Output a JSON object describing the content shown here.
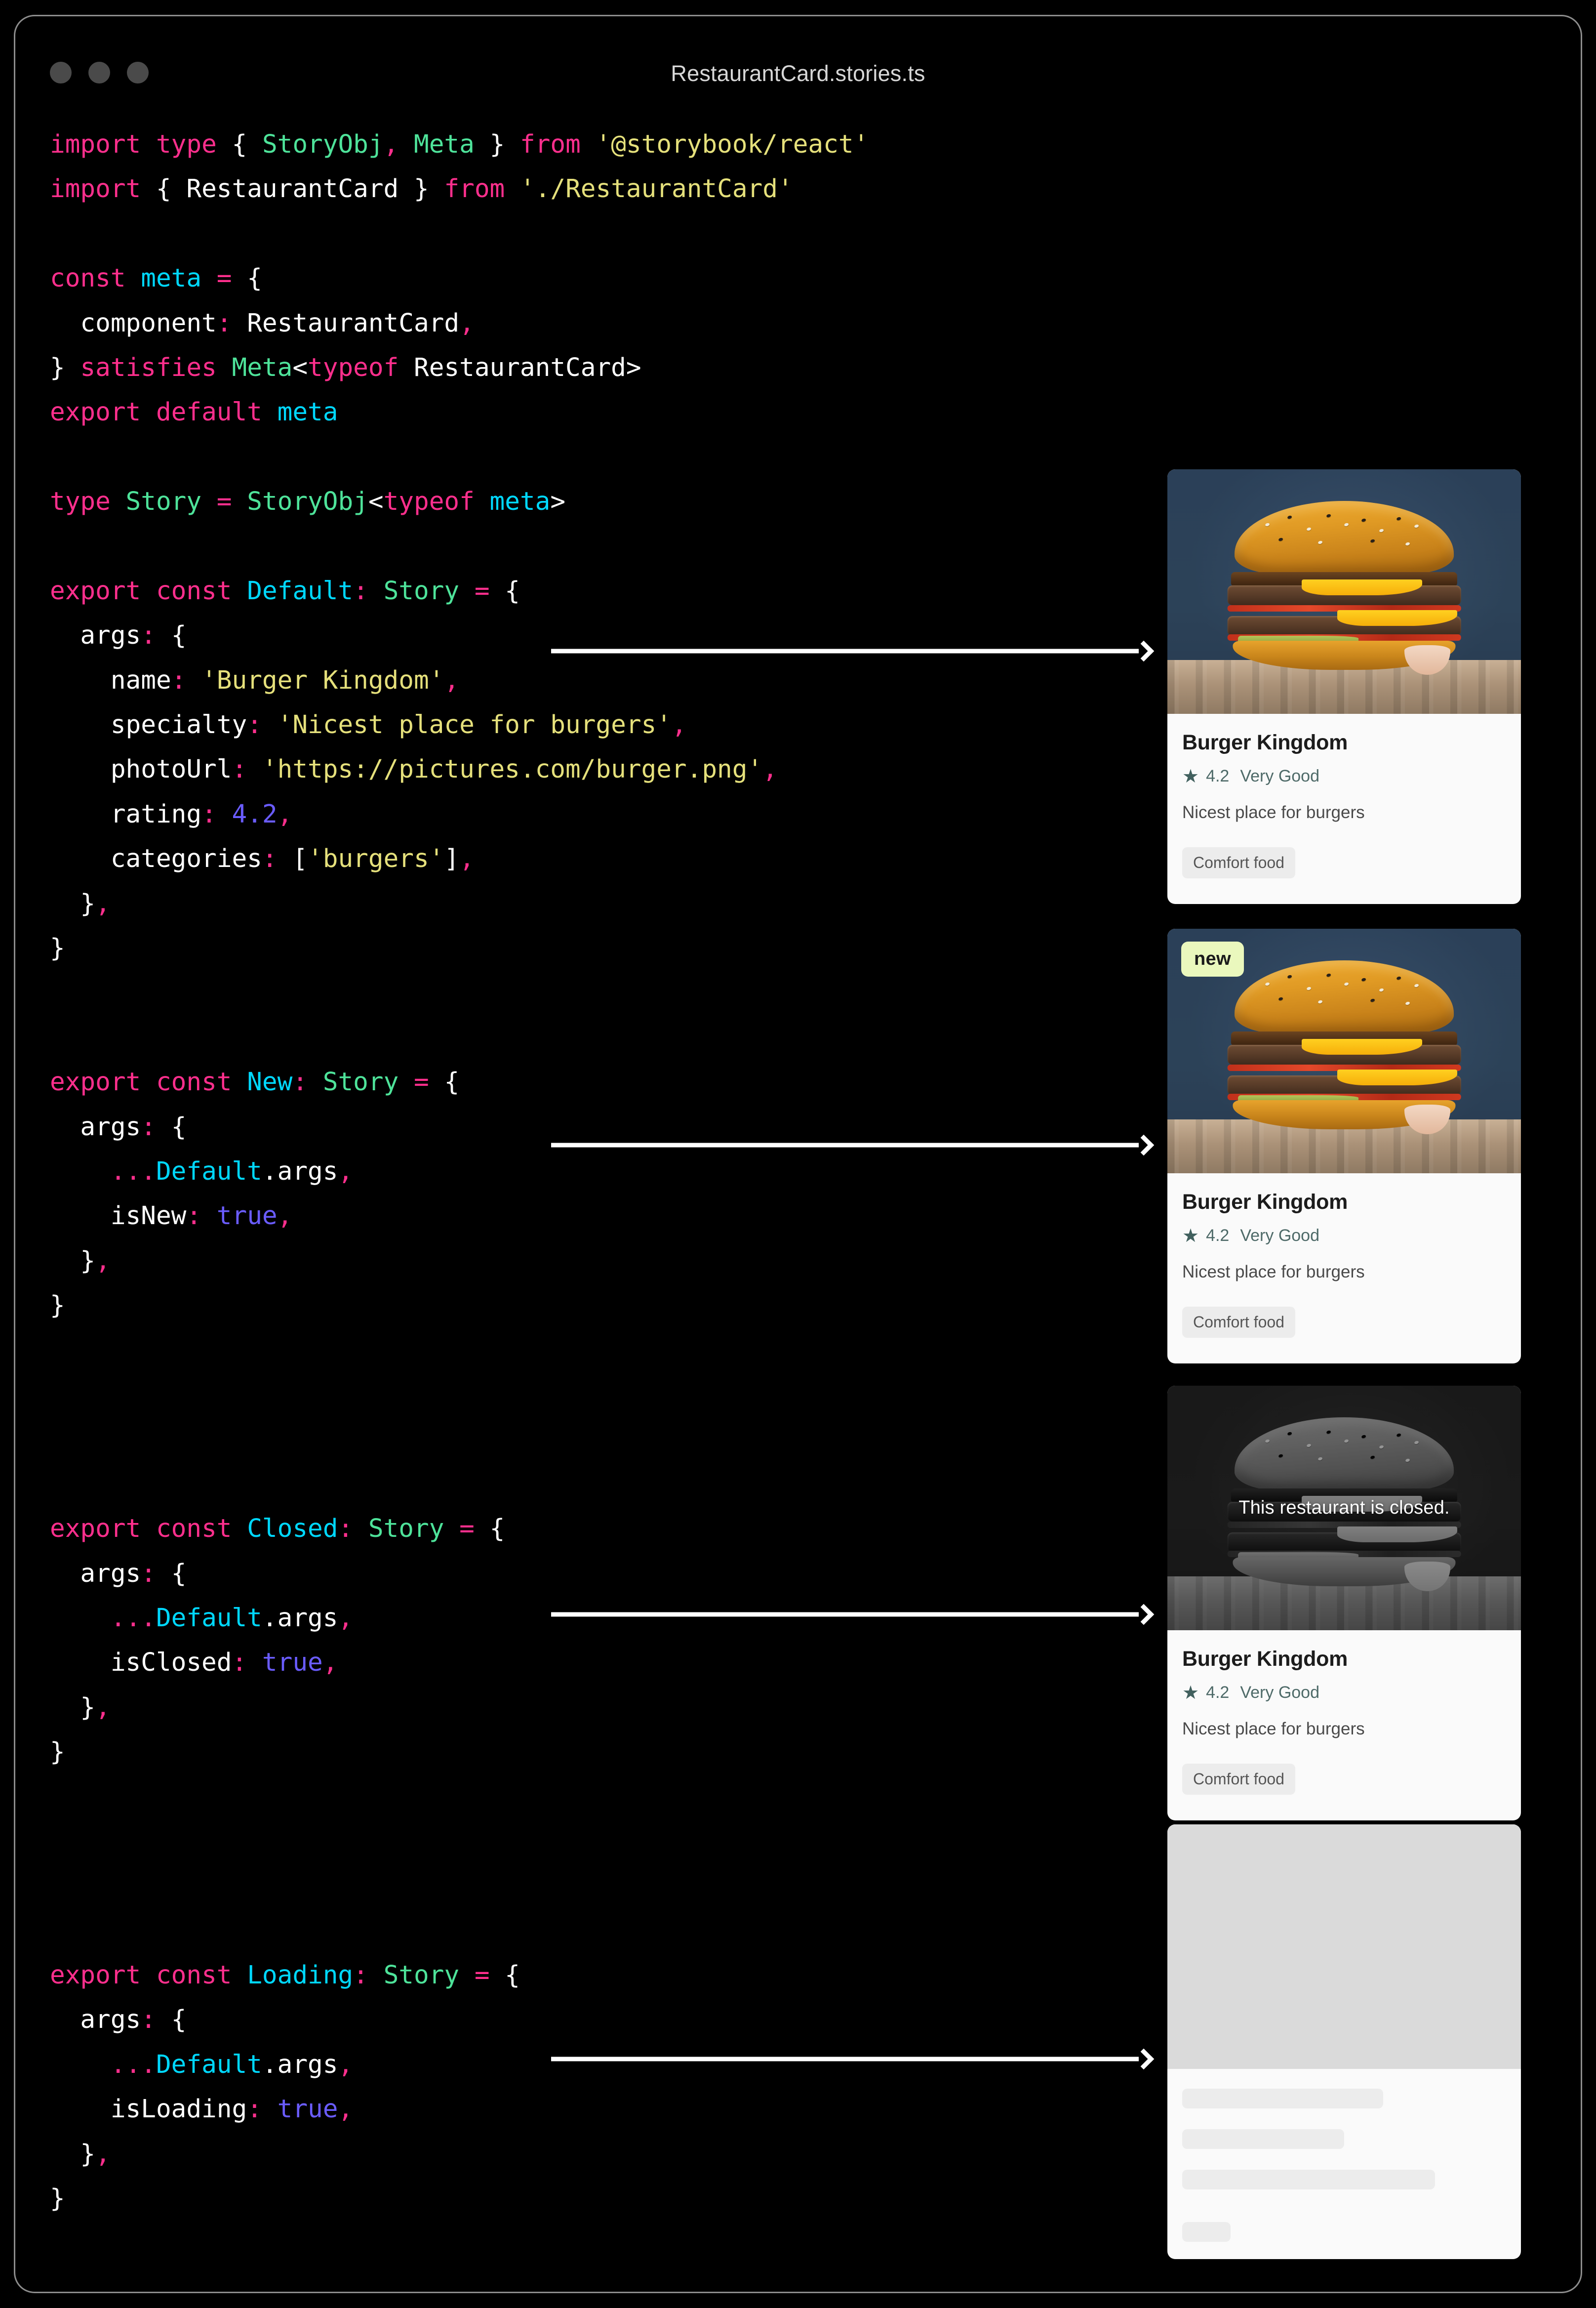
{
  "window": {
    "title": "RestaurantCard.stories.ts",
    "traffic_lights": [
      "close",
      "minimize",
      "maximize"
    ]
  },
  "theme": {
    "background": "#000000",
    "border": "#8d8d8d",
    "keyword": "#ff2f8d",
    "string": "#e5e07b",
    "identifier": "#00d8ff",
    "type": "#4ee39a",
    "number": "#6a5cff",
    "plain": "#ffffff",
    "card_bg": "#fafafa",
    "badge_new_bg": "#eaf8bd",
    "chip_bg": "#ececec",
    "rating_color": "#4e6a68",
    "skeleton_photo": "#dadada",
    "skeleton_bar": "#ececec"
  },
  "code": {
    "lines": [
      {
        "id": "l1",
        "text": "import type { StoryObj, Meta } from '@storybook/react'"
      },
      {
        "id": "l2",
        "text": "import { RestaurantCard } from './RestaurantCard'"
      },
      {
        "id": "l3",
        "text": ""
      },
      {
        "id": "l4",
        "text": "const meta = {"
      },
      {
        "id": "l5",
        "text": "  component: RestaurantCard,"
      },
      {
        "id": "l6",
        "text": "} satisfies Meta<typeof RestaurantCard>"
      },
      {
        "id": "l7",
        "text": "export default meta"
      },
      {
        "id": "l8",
        "text": ""
      },
      {
        "id": "l9",
        "text": "type Story = StoryObj<typeof meta>"
      },
      {
        "id": "l10",
        "text": ""
      },
      {
        "id": "l11",
        "text": "export const Default: Story = {"
      },
      {
        "id": "l12",
        "text": "  args: {"
      },
      {
        "id": "l13",
        "text": "    name: 'Burger Kingdom',"
      },
      {
        "id": "l14",
        "text": "    specialty: 'Nicest place for burgers',"
      },
      {
        "id": "l15",
        "text": "    photoUrl: 'https://pictures.com/burger.png',"
      },
      {
        "id": "l16",
        "text": "    rating: 4.2,"
      },
      {
        "id": "l17",
        "text": "    categories: ['burgers'],"
      },
      {
        "id": "l18",
        "text": "  },"
      },
      {
        "id": "l19",
        "text": "}"
      },
      {
        "id": "l20",
        "text": ""
      },
      {
        "id": "l21",
        "text": ""
      },
      {
        "id": "l22",
        "text": "export const New: Story = {"
      },
      {
        "id": "l23",
        "text": "  args: {"
      },
      {
        "id": "l24",
        "text": "    ...Default.args,"
      },
      {
        "id": "l25",
        "text": "    isNew: true,"
      },
      {
        "id": "l26",
        "text": "  },"
      },
      {
        "id": "l27",
        "text": "}"
      },
      {
        "id": "l28",
        "text": ""
      },
      {
        "id": "l29",
        "text": ""
      },
      {
        "id": "l30",
        "text": ""
      },
      {
        "id": "l31",
        "text": ""
      },
      {
        "id": "l32",
        "text": "export const Closed: Story = {"
      },
      {
        "id": "l33",
        "text": "  args: {"
      },
      {
        "id": "l34",
        "text": "    ...Default.args,"
      },
      {
        "id": "l35",
        "text": "    isClosed: true,"
      },
      {
        "id": "l36",
        "text": "  },"
      },
      {
        "id": "l37",
        "text": "}"
      },
      {
        "id": "l38",
        "text": ""
      },
      {
        "id": "l39",
        "text": ""
      },
      {
        "id": "l40",
        "text": ""
      },
      {
        "id": "l41",
        "text": ""
      },
      {
        "id": "l42",
        "text": "export const Loading: Story = {"
      },
      {
        "id": "l43",
        "text": "  args: {"
      },
      {
        "id": "l44",
        "text": "    ...Default.args,"
      },
      {
        "id": "l45",
        "text": "    isLoading: true,"
      },
      {
        "id": "l46",
        "text": "  },"
      },
      {
        "id": "l47",
        "text": "}"
      }
    ]
  },
  "arrows": [
    {
      "id": "arrow-default",
      "story": "Default"
    },
    {
      "id": "arrow-new",
      "story": "New"
    },
    {
      "id": "arrow-closed",
      "story": "Closed"
    },
    {
      "id": "arrow-loading",
      "story": "Loading"
    }
  ],
  "cards": {
    "default": {
      "name": "Burger Kingdom",
      "star": "★",
      "rating": "4.2",
      "rating_label": "Very Good",
      "specialty": "Nicest place for burgers",
      "chips": [
        "Comfort food"
      ]
    },
    "new": {
      "badge": "new",
      "name": "Burger Kingdom",
      "star": "★",
      "rating": "4.2",
      "rating_label": "Very Good",
      "specialty": "Nicest place for burgers",
      "chips": [
        "Comfort food"
      ]
    },
    "closed": {
      "overlay": "This restaurant is closed.",
      "name": "Burger Kingdom",
      "star": "★",
      "rating": "4.2",
      "rating_label": "Very Good",
      "specialty": "Nicest place for burgers",
      "chips": [
        "Comfort food"
      ]
    },
    "loading": {
      "bar_widths": [
        "62%",
        "50%",
        "78%",
        "15%"
      ]
    }
  }
}
